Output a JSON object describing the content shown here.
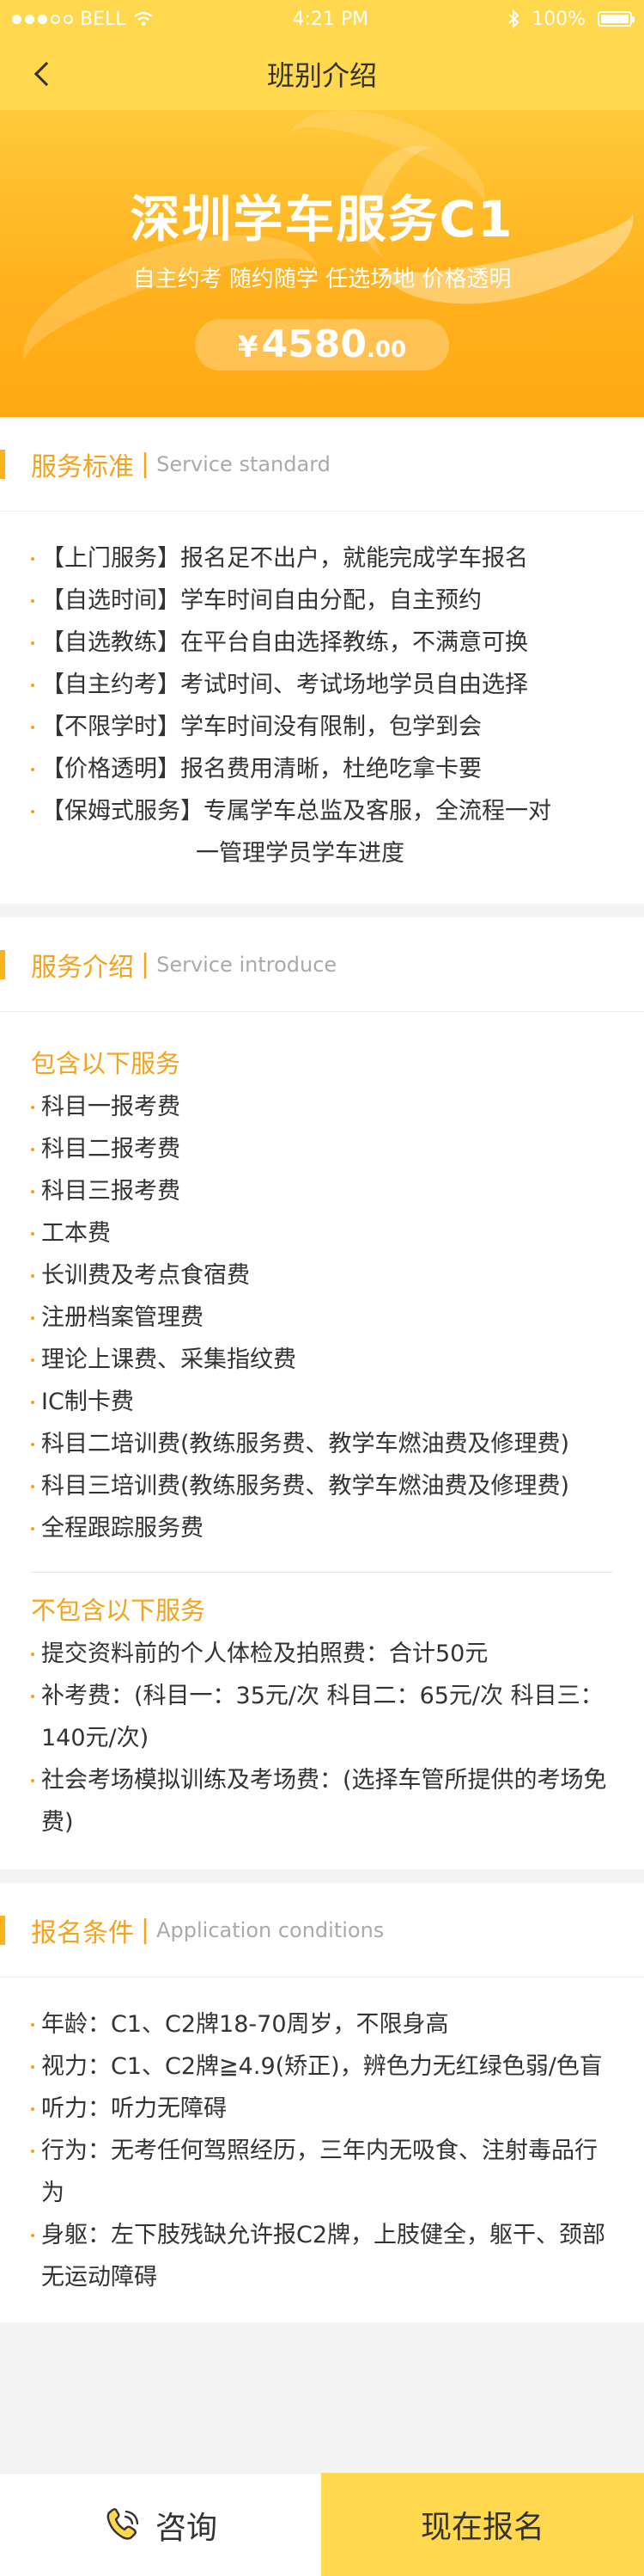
{
  "status_bar": {
    "carrier": "BELL",
    "time": "4:21 PM",
    "battery": "100%"
  },
  "nav": {
    "title": "班别介绍",
    "back_icon": "chevron-left-icon"
  },
  "banner": {
    "title": "深圳学车服务C1",
    "subtitle": "自主约考 随约随学 任选场地 价格透明",
    "price_currency": "¥",
    "price_integer": "4580",
    "price_decimal": ".00"
  },
  "standard": {
    "title": "服务标准",
    "separator": "|",
    "title_en": "Service standard",
    "items": [
      "【上门服务】报名足不出户，就能完成学车报名",
      "【自选时间】学车时间自由分配，自主预约",
      "【自选教练】在平台自由选择教练，不满意可换",
      "【自主约考】考试时间、考试场地学员自由选择",
      "【不限学时】学车时间没有限制，包学到会",
      "【价格透明】报名费用清晰，杜绝吃拿卡要"
    ],
    "last_item_line1": "【保姆式服务】专属学车总监及客服，全流程一对",
    "last_item_line2": "一管理学员学车进度"
  },
  "intro": {
    "title": "服务介绍",
    "separator": "|",
    "title_en": "Service introduce",
    "included_title": "包含以下服务",
    "included": [
      "科目一报考费",
      "科目二报考费",
      "科目三报考费",
      "工本费",
      "长训费及考点食宿费",
      "注册档案管理费",
      "理论上课费、采集指纹费",
      "IC制卡费",
      "科目二培训费(教练服务费、教学车燃油费及修理费)",
      "科目三培训费(教练服务费、教学车燃油费及修理费)",
      "全程跟踪服务费"
    ],
    "excluded_title": "不包含以下服务",
    "excluded": [
      "提交资料前的个人体检及拍照费：合计50元",
      "补考费：(科目一：35元/次  科目二：65元/次  科目三：140元/次)",
      "社会考场模拟训练及考场费：(选择车管所提供的考场免费)"
    ]
  },
  "conditions": {
    "title": "报名条件",
    "separator": "|",
    "title_en": "Application conditions",
    "items": [
      "年龄：C1、C2牌18-70周岁，不限身高",
      "视力：C1、C2牌≧4.9(矫正)，辨色力无红绿色弱/色盲",
      "听力：听力无障碍",
      "行为：无考任何驾照经历，三年内无吸食、注射毒品行为",
      "身躯：左下肢残缺允许报C2牌，上肢健全，躯干、颈部无运动障碍"
    ]
  },
  "bottom": {
    "consult_label": "咨询",
    "consult_icon": "headset-chat-icon",
    "signup_label": "现在报名"
  },
  "colors": {
    "accent": "#f5a31a",
    "bar": "#ffd84d",
    "banner": "#ffb21e"
  }
}
